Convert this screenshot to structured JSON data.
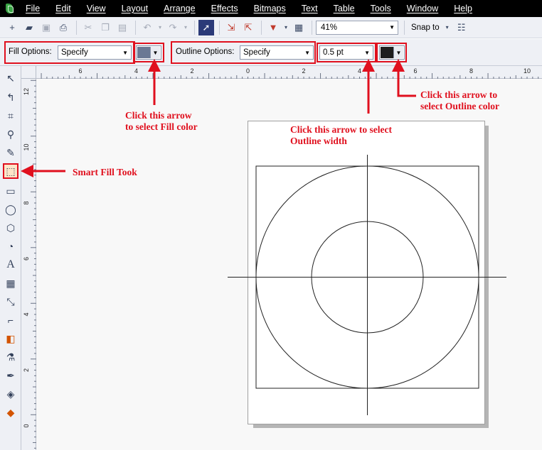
{
  "menu": {
    "items": [
      "File",
      "Edit",
      "View",
      "Layout",
      "Arrange",
      "Effects",
      "Bitmaps",
      "Text",
      "Table",
      "Tools",
      "Window",
      "Help"
    ]
  },
  "standard_toolbar": {
    "zoom_value": "41%",
    "snap_label": "Snap to"
  },
  "property_bar": {
    "fill_options_label": "Fill Options:",
    "fill_options_value": "Specify",
    "fill_color": "#6a7894",
    "outline_options_label": "Outline Options:",
    "outline_options_value": "Specify",
    "outline_width_value": "0.5 pt",
    "outline_color": "#1e1e1e"
  },
  "rulers": {
    "horizontal_labels": [
      "6",
      "4",
      "2",
      "0",
      "2",
      "4",
      "6",
      "8",
      "10"
    ],
    "vertical_labels": [
      "12",
      "10",
      "8",
      "6",
      "4",
      "2",
      "0"
    ]
  },
  "annotations": {
    "fill_color": [
      "Click this arrow",
      "to select Fill color"
    ],
    "outline_width": [
      "Click this arrow to select",
      "Outline width"
    ],
    "outline_color": [
      "Click this arrow to",
      "select Outline color"
    ],
    "smart_fill": "Smart Fill Took"
  },
  "colors": {
    "annotation_red": "#e0101e",
    "highlight": "#fde6c8"
  }
}
